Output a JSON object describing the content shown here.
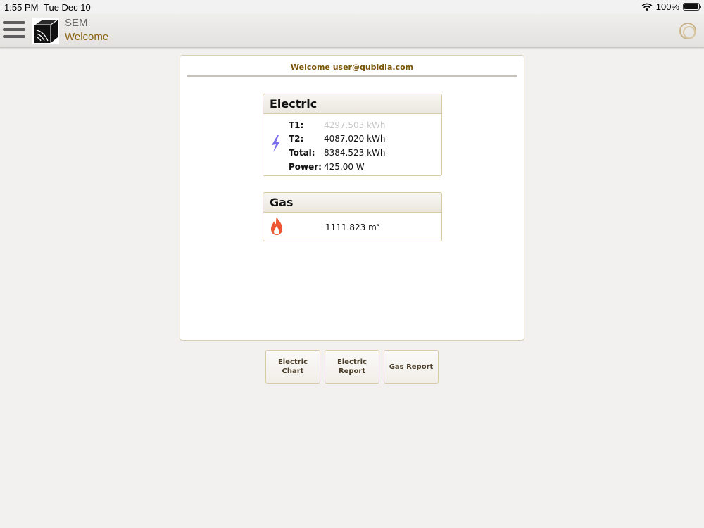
{
  "status_bar": {
    "time": "1:55 PM",
    "date": "Tue Dec 10",
    "battery": "100%"
  },
  "header": {
    "app_name": "SEM",
    "subtitle": "Welcome"
  },
  "welcome_text": "Welcome user@qubidia.com",
  "electric": {
    "title": "Electric",
    "rows": [
      {
        "label": "T1:",
        "value": "4297.503 kWh"
      },
      {
        "label": "T2:",
        "value": "4087.020 kWh"
      },
      {
        "label": "Total:",
        "value": "8384.523 kWh"
      },
      {
        "label": "Power:",
        "value": "425.00 W"
      }
    ]
  },
  "gas": {
    "title": "Gas",
    "value": "1111.823 m³"
  },
  "buttons": {
    "electric_chart": "Electric Chart",
    "electric_report": "Electric Report",
    "gas_report": "Gas Report"
  },
  "colors": {
    "accent": "#8a6212",
    "bolt": "#7b6ef0",
    "flame": "#ee5533"
  },
  "icons": [
    "menu-icon",
    "sem-logo",
    "wifi-icon",
    "battery-icon",
    "loading-spinner-icon",
    "lightning-bolt-icon",
    "flame-icon"
  ]
}
